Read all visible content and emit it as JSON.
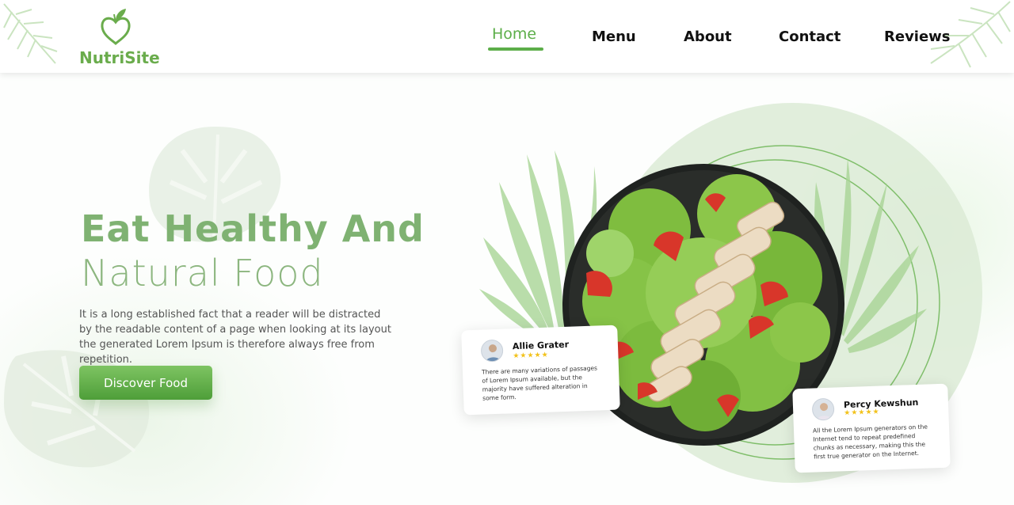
{
  "brand": {
    "name": "NutriSite",
    "accent": "#5cae49"
  },
  "nav": {
    "items": [
      {
        "label": "Home",
        "active": true
      },
      {
        "label": "Menu",
        "active": false
      },
      {
        "label": "About",
        "active": false
      },
      {
        "label": "Contact",
        "active": false
      },
      {
        "label": "Reviews",
        "active": false
      }
    ]
  },
  "hero": {
    "title_line1": "Eat Healthy And",
    "title_line2": "Natural Food",
    "description": "It is a long established fact that a reader will be distracted by the readable content of a page when looking at its layout the generated Lorem Ipsum is therefore always free from repetition.",
    "cta_label": "Discover Food"
  },
  "reviews": [
    {
      "name": "Allie Grater",
      "stars": "★★★★★",
      "rating": 5,
      "text": "There are many variations of passages of Lorem Ipsum available, but the majority have suffered alteration in some form."
    },
    {
      "name": "Percy Kewshun",
      "stars": "★★★★★",
      "rating": 5,
      "text": "All the Lorem Ipsum generators on the Internet tend to repeat predefined chunks as necessary, making this the first true generator on the Internet."
    }
  ],
  "icons": {
    "logo": "apple-heart-icon",
    "decor": "palm-leaf-icon",
    "monstera": "monstera-leaf-icon"
  }
}
